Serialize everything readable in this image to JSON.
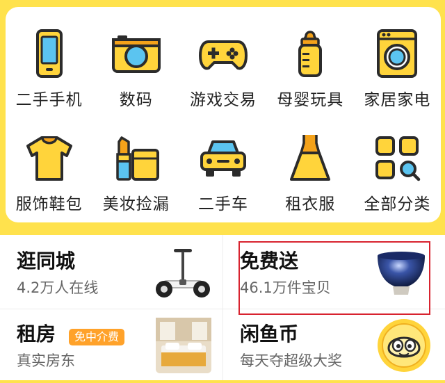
{
  "categories": [
    {
      "label": "二手手机",
      "icon": "phone-icon"
    },
    {
      "label": "数码",
      "icon": "camera-icon"
    },
    {
      "label": "游戏交易",
      "icon": "gamepad-icon"
    },
    {
      "label": "母婴玩具",
      "icon": "baby-bottle-icon"
    },
    {
      "label": "家居家电",
      "icon": "washing-machine-icon"
    },
    {
      "label": "服饰鞋包",
      "icon": "tshirt-icon"
    },
    {
      "label": "美妆捡漏",
      "icon": "makeup-icon"
    },
    {
      "label": "二手车",
      "icon": "car-icon"
    },
    {
      "label": "租衣服",
      "icon": "dress-icon"
    },
    {
      "label": "全部分类",
      "icon": "all-categories-icon"
    }
  ],
  "services": {
    "local": {
      "title": "逛同城",
      "subtitle": "4.2万人在线",
      "image": "self-balancing-scooter"
    },
    "free": {
      "title": "免费送",
      "subtitle": "46.1万件宝贝",
      "image": "blue-glaze-bowl"
    },
    "rent": {
      "title": "租房",
      "badge": "免中介费",
      "subtitle": "真实房东",
      "image": "bedroom-photo"
    },
    "coin": {
      "title": "闲鱼币",
      "subtitle": "每天夺超级大奖",
      "image": "fish-coin-mascot"
    }
  },
  "colors": {
    "brand_yellow": "#FFE24D",
    "icon_yellow": "#FFD43B",
    "icon_blue": "#5BC4F0",
    "icon_outline": "#2B2B2B",
    "badge_orange": "#FFA22A",
    "highlight_red": "#D8232F"
  }
}
